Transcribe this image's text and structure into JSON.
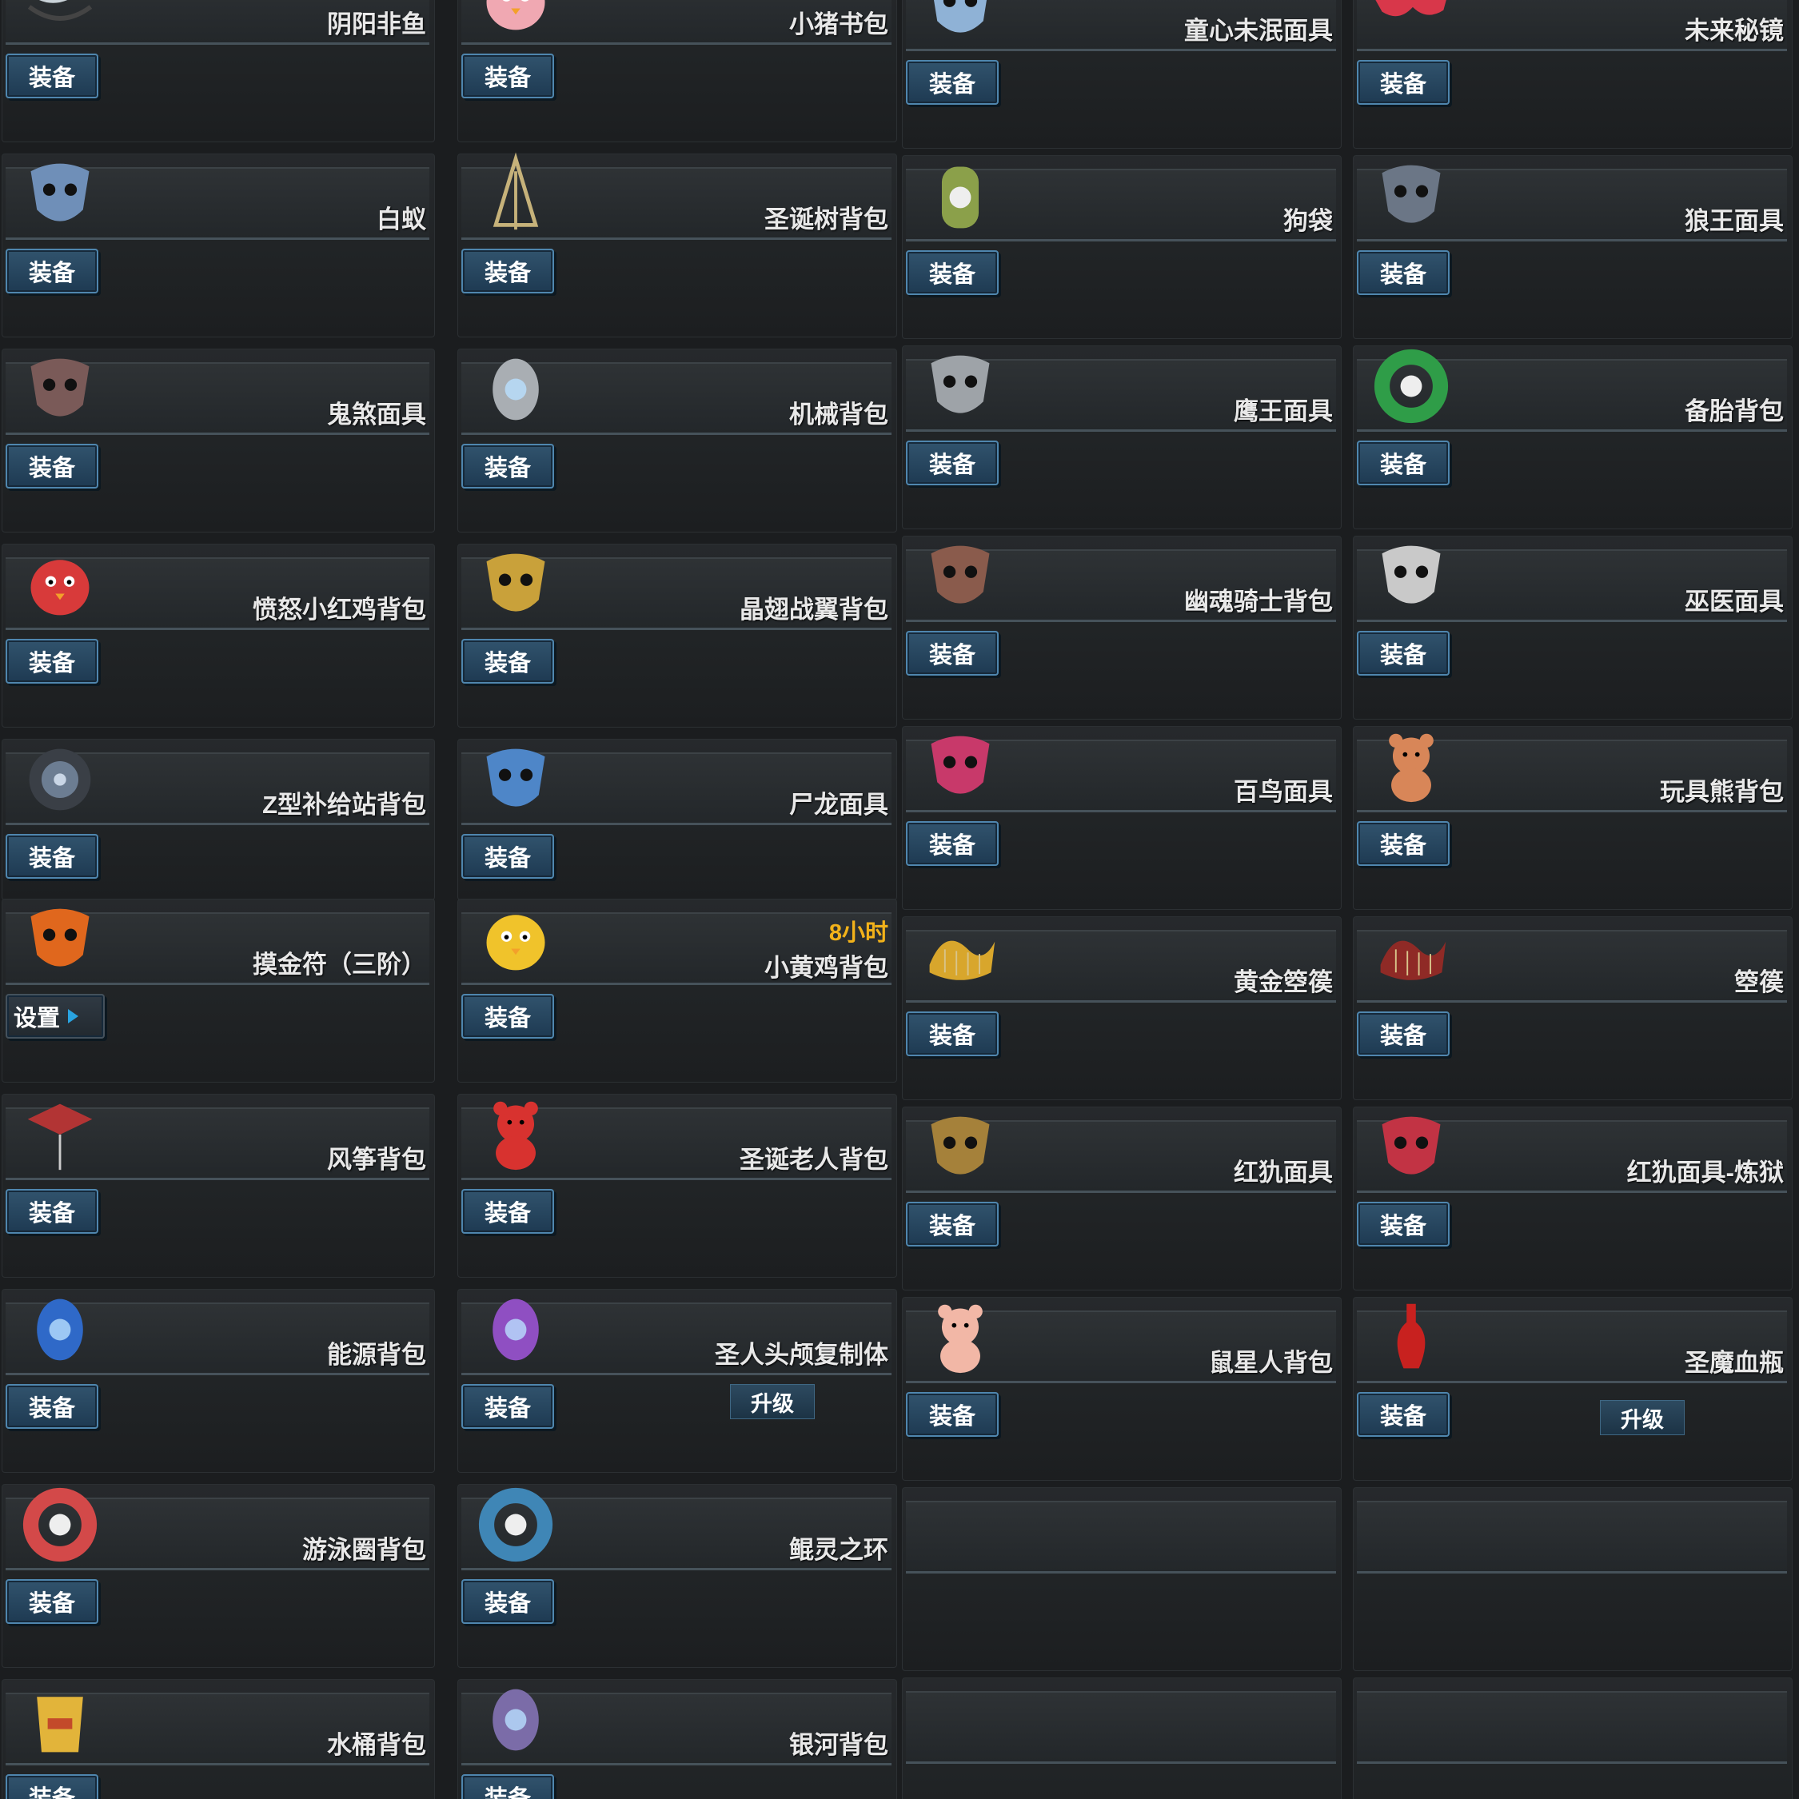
{
  "equip_label": "装备",
  "set_label": "设置",
  "upgrade_label": "升级",
  "columns": [
    {
      "items": [
        {
          "name": "阴阳非鱼",
          "icon": "yin-yang-fish-icon",
          "color": "#c9d2d8",
          "action": "equip"
        },
        {
          "name": "白蚁",
          "icon": "termite-icon",
          "color": "#6f8fb8",
          "action": "equip"
        },
        {
          "name": "鬼煞面具",
          "icon": "ghost-mask-icon",
          "color": "#7a5a58",
          "action": "equip"
        },
        {
          "name": "愤怒小红鸡背包",
          "icon": "angry-red-bird-icon",
          "color": "#d83a3a",
          "action": "equip"
        },
        {
          "name": "Z型补给站背包",
          "icon": "supply-station-icon",
          "color": "#6c7d92",
          "action": "equip"
        },
        {
          "name": "摸金符（三阶）",
          "icon": "golden-amulet-icon",
          "color": "#e0671d",
          "action": "set"
        },
        {
          "name": "风筝背包",
          "icon": "kite-icon",
          "color": "#b23434",
          "action": "equip"
        },
        {
          "name": "能源背包",
          "icon": "energy-pack-icon",
          "color": "#2f69c8",
          "action": "equip"
        },
        {
          "name": "游泳圈背包",
          "icon": "swim-ring-icon",
          "color": "#d34949",
          "action": "equip"
        },
        {
          "name": "水桶背包",
          "icon": "bucket-icon",
          "color": "#e2b43a",
          "action": "equip"
        }
      ]
    },
    {
      "items": [
        {
          "name": "小猪书包",
          "icon": "piggy-bag-icon",
          "color": "#f0a8b2",
          "action": "equip"
        },
        {
          "name": "圣诞树背包",
          "icon": "christmas-tree-icon",
          "color": "#c6b27a",
          "action": "equip"
        },
        {
          "name": "机械背包",
          "icon": "mechanical-pack-icon",
          "color": "#a9aeb3",
          "action": "equip"
        },
        {
          "name": "晶翅战翼背包",
          "icon": "crystal-wing-icon",
          "color": "#c9a13a",
          "action": "equip"
        },
        {
          "name": "尸龙面具",
          "icon": "bone-dragon-mask-icon",
          "color": "#4e86c8",
          "action": "equip"
        },
        {
          "name": "小黄鸡背包",
          "icon": "yellow-chick-icon",
          "color": "#f0c32b",
          "action": "equip",
          "timer": "8小时"
        },
        {
          "name": "圣诞老人背包",
          "icon": "santa-icon",
          "color": "#d8322f",
          "action": "equip"
        },
        {
          "name": "圣人头颅复制体",
          "icon": "saint-skull-icon",
          "color": "#8f4fc2",
          "action": "equip",
          "upgrade": true
        },
        {
          "name": "鲲灵之环",
          "icon": "kun-ring-icon",
          "color": "#3f86b6",
          "action": "equip"
        },
        {
          "name": "银河背包",
          "icon": "galaxy-pack-icon",
          "color": "#7b6ca8",
          "action": "equip"
        }
      ]
    },
    {
      "items": [
        {
          "name": "童心未泯面具",
          "icon": "child-mask-icon",
          "color": "#8fb2d6",
          "action": "equip"
        },
        {
          "name": "狗袋",
          "icon": "dog-bag-icon",
          "color": "#8ba04a",
          "action": "equip"
        },
        {
          "name": "鹰王面具",
          "icon": "eagle-mask-icon",
          "color": "#9ea3a8",
          "action": "equip"
        },
        {
          "name": "幽魂骑士背包",
          "icon": "ghost-knight-icon",
          "color": "#8a5b4c",
          "action": "equip"
        },
        {
          "name": "百鸟面具",
          "icon": "feather-mask-icon",
          "color": "#c8396a",
          "action": "equip"
        },
        {
          "name": "黄金箜篌",
          "icon": "golden-harp-icon",
          "color": "#d8a62c",
          "action": "equip"
        },
        {
          "name": "红犰面具",
          "icon": "red-beast-mask-icon",
          "color": "#a5813a",
          "action": "equip"
        },
        {
          "name": "鼠星人背包",
          "icon": "hamster-icon",
          "color": "#f2b7a6",
          "action": "equip"
        },
        {
          "name": "",
          "icon": "",
          "color": "",
          "action": "none"
        },
        {
          "name": "",
          "icon": "",
          "color": "",
          "action": "none"
        }
      ]
    },
    {
      "items": [
        {
          "name": "未来秘镜",
          "icon": "future-glasses-icon",
          "color": "#d8374a",
          "action": "equip"
        },
        {
          "name": "狼王面具",
          "icon": "wolf-mask-icon",
          "color": "#6b7686",
          "action": "equip"
        },
        {
          "name": "备胎背包",
          "icon": "spare-tire-icon",
          "color": "#2f9d48",
          "action": "equip"
        },
        {
          "name": "巫医面具",
          "icon": "plague-mask-icon",
          "color": "#c9c9c9",
          "action": "equip"
        },
        {
          "name": "玩具熊背包",
          "icon": "teddy-bear-icon",
          "color": "#d88658",
          "action": "equip"
        },
        {
          "name": "箜篌",
          "icon": "harp-icon",
          "color": "#8f2a26",
          "action": "equip"
        },
        {
          "name": "红犰面具-炼狱",
          "icon": "inferno-mask-icon",
          "color": "#c23344",
          "action": "equip"
        },
        {
          "name": "圣魔血瓶",
          "icon": "blood-vial-icon",
          "color": "#c8211f",
          "action": "equip",
          "upgrade": true
        },
        {
          "name": "",
          "icon": "",
          "color": "",
          "action": "none"
        },
        {
          "name": "",
          "icon": "",
          "color": "",
          "action": "none"
        }
      ]
    }
  ]
}
